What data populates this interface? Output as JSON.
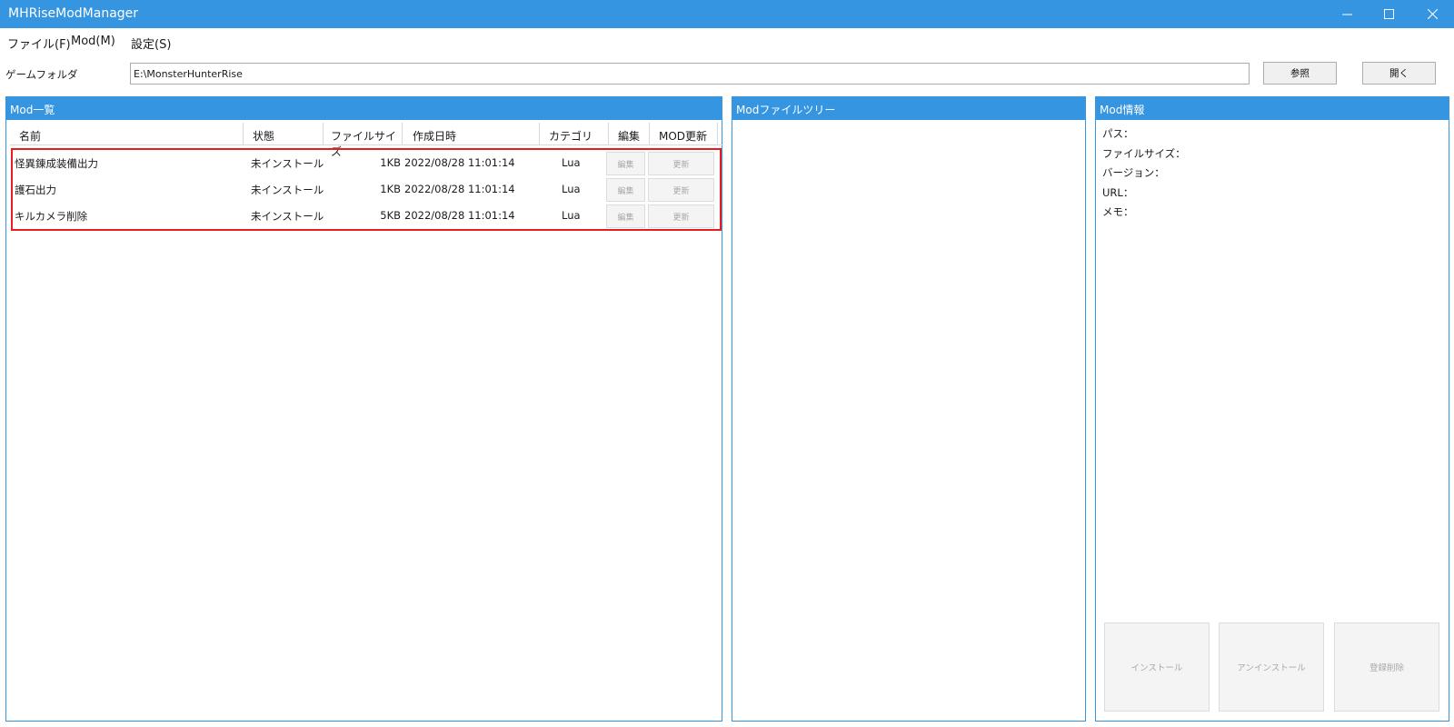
{
  "window": {
    "title": "MHRiseModManager"
  },
  "menu": [
    "ファイル(F)",
    "Mod(M)",
    "設定(S)"
  ],
  "folder": {
    "label": "ゲームフォルダ",
    "value": "E:\\MonsterHunterRise",
    "browse_label": "参照",
    "open_label": "開く"
  },
  "mod_list": {
    "header": "Mod一覧",
    "columns": [
      "名前",
      "状態",
      "ファイルサイズ",
      "作成日時",
      "カテゴリ",
      "編集",
      "MOD更新"
    ],
    "rows": [
      {
        "name": "怪異錬成装備出力",
        "status": "未インストール",
        "size": "1KB",
        "date": "2022/08/28 11:01:14",
        "category": "Lua",
        "edit": "編集",
        "update": "更新"
      },
      {
        "name": "護石出力",
        "status": "未インストール",
        "size": "1KB",
        "date": "2022/08/28 11:01:14",
        "category": "Lua",
        "edit": "編集",
        "update": "更新"
      },
      {
        "name": "キルカメラ削除",
        "status": "未インストール",
        "size": "5KB",
        "date": "2022/08/28 11:01:14",
        "category": "Lua",
        "edit": "編集",
        "update": "更新"
      }
    ]
  },
  "file_tree": {
    "header": "Modファイルツリー"
  },
  "mod_info": {
    "header": "Mod情報",
    "fields": [
      "パス：",
      "ファイルサイズ：",
      "バージョン：",
      "URL：",
      "メモ："
    ],
    "buttons": [
      "インストール",
      "アンインストール",
      "登録削除"
    ]
  }
}
